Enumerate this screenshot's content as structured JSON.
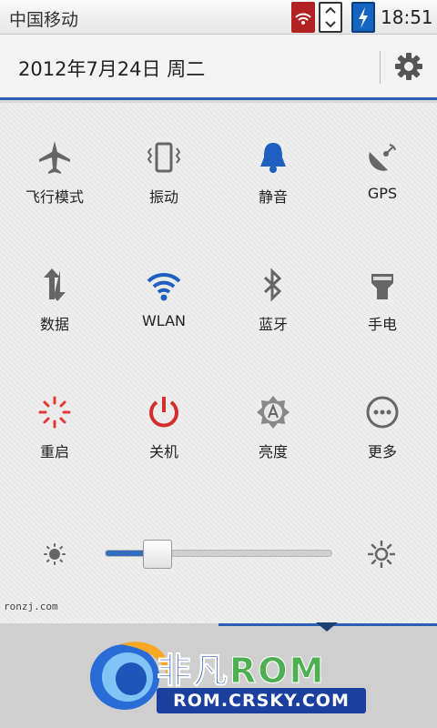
{
  "status_bar": {
    "carrier": "中国移动",
    "time": "18:51"
  },
  "header": {
    "date": "2012年7月24日 周二"
  },
  "toggles": [
    {
      "label": "飞行模式",
      "icon": "airplane-icon"
    },
    {
      "label": "振动",
      "icon": "vibrate-icon"
    },
    {
      "label": "静音",
      "icon": "bell-icon"
    },
    {
      "label": "GPS",
      "icon": "gps-icon"
    },
    {
      "label": "数据",
      "icon": "data-sync-icon"
    },
    {
      "label": "WLAN",
      "icon": "wifi-icon"
    },
    {
      "label": "蓝牙",
      "icon": "bluetooth-icon"
    },
    {
      "label": "手电",
      "icon": "flashlight-icon"
    },
    {
      "label": "重启",
      "icon": "reboot-icon"
    },
    {
      "label": "关机",
      "icon": "power-icon"
    },
    {
      "label": "亮度",
      "icon": "brightness-auto-icon"
    },
    {
      "label": "更多",
      "icon": "more-icon"
    }
  ],
  "brightness": {
    "level": 0.15
  },
  "watermark": "ronzj.com",
  "logo": {
    "brand_cn": "非凡",
    "brand_rom": "ROM",
    "url": "ROM.CRSKY.COM"
  },
  "colors": {
    "accent": "#2a5fb5",
    "bell": "#1e5fbf",
    "wifi": "#1e5fbf",
    "power": "#d32f2f",
    "reboot": "#e53935"
  }
}
